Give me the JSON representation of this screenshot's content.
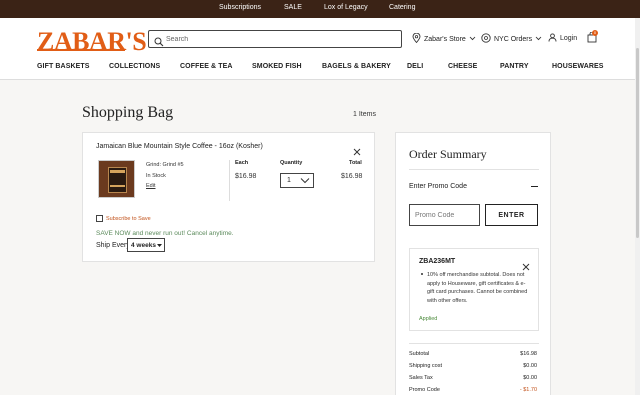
{
  "topbar": {
    "links": [
      "Subscriptions",
      "SALE",
      "Lox of Legacy",
      "Catering"
    ]
  },
  "header": {
    "logo": "ZABAR'S",
    "search_placeholder": "Search",
    "store_label": "Zabar's Store",
    "orders_label": "NYC Orders",
    "login_label": "Login",
    "cart_count": "0"
  },
  "nav": [
    "GIFT BASKETS",
    "COLLECTIONS",
    "COFFEE & TEA",
    "SMOKED FISH",
    "BAGELS & BAKERY",
    "DELI",
    "CHEESE",
    "PANTRY",
    "HOUSEWARES"
  ],
  "page": {
    "title": "Shopping Bag",
    "items_count": "1 Items"
  },
  "cart_item": {
    "name": "Jamaican Blue Mountain Style Coffee - 16oz (Kosher)",
    "grind": "Grind: Grind #5",
    "stock": "In Stock",
    "edit": "Edit",
    "each_label": "Each",
    "qty_label": "Quantity",
    "total_label": "Total",
    "each_price": "$16.98",
    "qty_value": "1",
    "total_price": "$16.98",
    "subscribe_label": "Subscribe to Save",
    "save_now": "SAVE NOW and never run out! Cancel anytime.",
    "ship_every_label": "Ship Every",
    "ship_every_value": "4 weeks"
  },
  "summary": {
    "title": "Order Summary",
    "promo_header": "Enter Promo Code",
    "promo_placeholder": "Promo Code",
    "enter_button": "ENTER",
    "coupon_code": "ZBA236MT",
    "coupon_desc": "10% off merchandise subtotal. Does not apply to Houseware, gift certificates & e-gift card purchases. Cannot be combined with other offers.",
    "coupon_status": "Applied",
    "rows": [
      {
        "label": "Subtotal",
        "value": "$16.98"
      },
      {
        "label": "Shipping cost",
        "value": "$0.00"
      },
      {
        "label": "Sales Tax",
        "value": "$0.00"
      },
      {
        "label": "Promo Code",
        "value": "- $1.70"
      }
    ]
  },
  "colors": {
    "brand": "#e15d16",
    "topbar": "#3b2316",
    "applied": "#4a8a3a",
    "promo_discount": "#c2521b"
  }
}
